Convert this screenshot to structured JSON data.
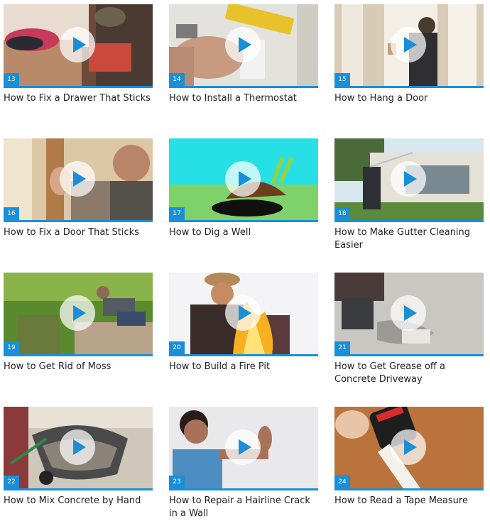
{
  "videos": [
    {
      "number": "13",
      "title": "How to Fix a Drawer That Sticks"
    },
    {
      "number": "14",
      "title": "How to Install a Thermostat"
    },
    {
      "number": "15",
      "title": "How to Hang a Door"
    },
    {
      "number": "16",
      "title": "How to Fix a Door That Sticks"
    },
    {
      "number": "17",
      "title": "How to Dig a Well"
    },
    {
      "number": "18",
      "title": "How to Make Gutter Cleaning Easier"
    },
    {
      "number": "19",
      "title": "How to Get Rid of Moss"
    },
    {
      "number": "20",
      "title": "How to Build a Fire Pit"
    },
    {
      "number": "21",
      "title": "How to Get Grease off a Concrete Driveway"
    },
    {
      "number": "22",
      "title": "How to Mix Concrete by Hand"
    },
    {
      "number": "23",
      "title": "How to Repair a Hairline Crack in a Wall"
    },
    {
      "number": "24",
      "title": "How to Read a Tape Measure"
    }
  ],
  "icons": {
    "play": "play-icon"
  },
  "colors": {
    "accent": "#1a8fd8",
    "play_triangle": "#1a8fd8"
  }
}
